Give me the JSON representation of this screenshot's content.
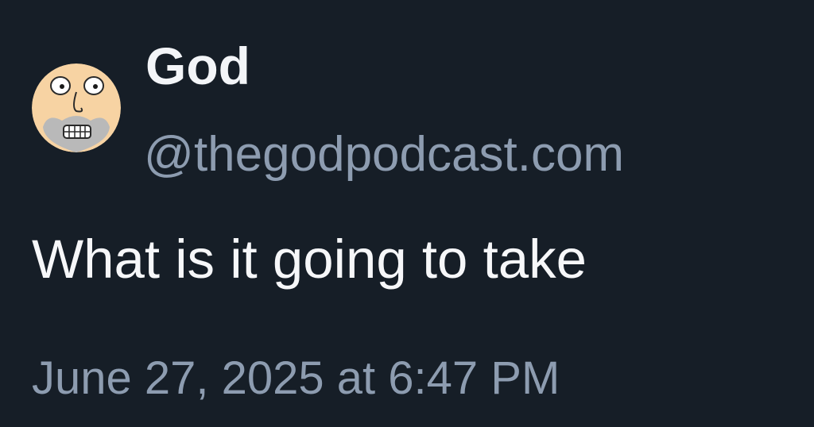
{
  "post": {
    "author": {
      "display_name": "God",
      "handle": "@thegodpodcast.com",
      "avatar_icon": "cartoon-face-avatar"
    },
    "text": "What is it going to take",
    "timestamp": "June 27, 2025 at 6:47 PM"
  },
  "colors": {
    "background": "#161e27",
    "primary_text": "#f3f5f8",
    "secondary_text": "#8d9cb0",
    "avatar_skin": "#f7d3a3"
  }
}
